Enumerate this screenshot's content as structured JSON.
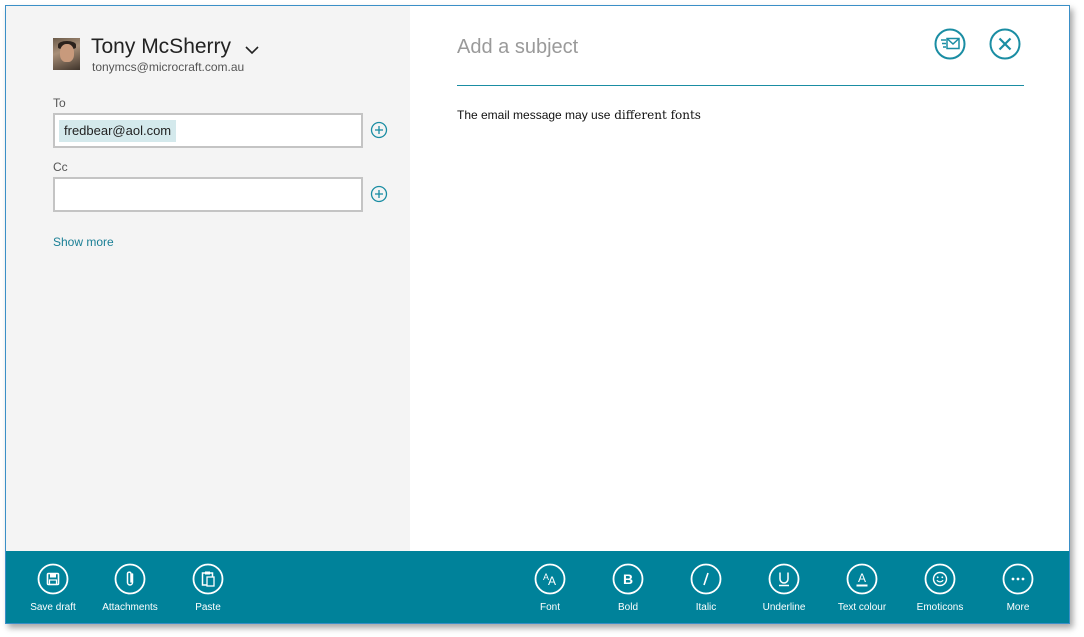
{
  "account": {
    "name": "Tony McSherry",
    "email": "tonymcs@microcraft.com.au"
  },
  "to": {
    "label": "To",
    "recipients": [
      "fredbear@aol.com"
    ]
  },
  "cc": {
    "label": "Cc",
    "value": ""
  },
  "show_more": "Show more",
  "subject": {
    "placeholder": "Add a subject"
  },
  "message": {
    "part1": "The email message may use",
    "part2": "different fonts"
  },
  "app_bar": {
    "left": [
      {
        "label": "Save draft",
        "icon": "save-icon"
      },
      {
        "label": "Attachments",
        "icon": "paperclip-icon"
      },
      {
        "label": "Paste",
        "icon": "clipboard-icon"
      }
    ],
    "right": [
      {
        "label": "Font",
        "icon": "font-icon"
      },
      {
        "label": "Bold",
        "icon": "bold-icon"
      },
      {
        "label": "Italic",
        "icon": "italic-icon"
      },
      {
        "label": "Underline",
        "icon": "underline-icon"
      },
      {
        "label": "Text colour",
        "icon": "text-colour-icon"
      },
      {
        "label": "Emoticons",
        "icon": "emoticon-icon"
      },
      {
        "label": "More",
        "icon": "more-icon"
      }
    ]
  },
  "colors": {
    "accent": "#00829a",
    "link": "#1a7f95",
    "left_pane_bg": "#f4f4f4",
    "chip_bg": "#d4e9ec"
  }
}
